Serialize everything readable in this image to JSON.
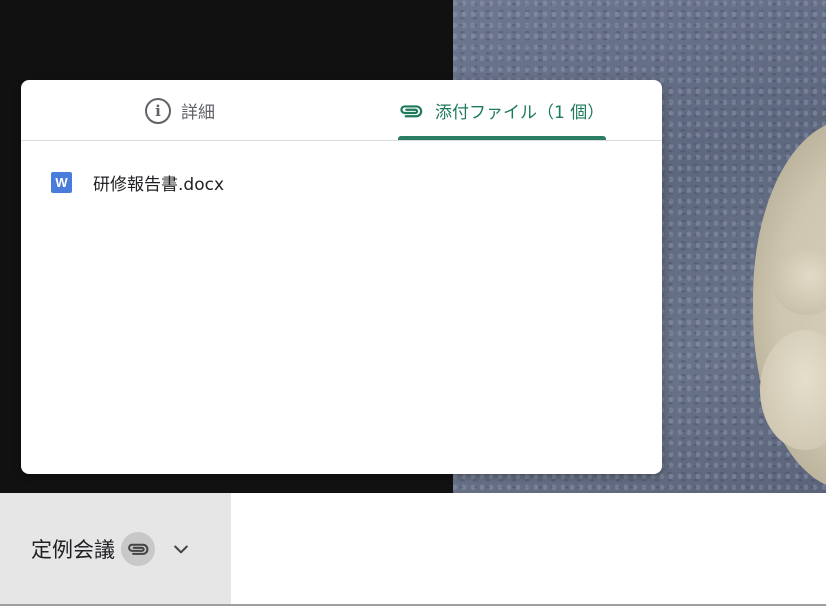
{
  "panel": {
    "tabs": [
      {
        "label": "詳細",
        "icon": "info-icon"
      },
      {
        "label": "添付ファイル（1 個）",
        "icon": "paperclip-icon",
        "selected": true
      }
    ],
    "files": [
      {
        "name": "研修報告書.docx",
        "icon": "word-doc-icon",
        "icon_letter": "W"
      }
    ]
  },
  "meeting": {
    "title": "定例会議",
    "attachment_icon": "paperclip-icon",
    "expand_icon": "chevron-down-icon"
  },
  "colors": {
    "accent": "#1e7a5a",
    "tab_indicator": "#2a7c63",
    "word_blue": "#4a7ddb"
  }
}
